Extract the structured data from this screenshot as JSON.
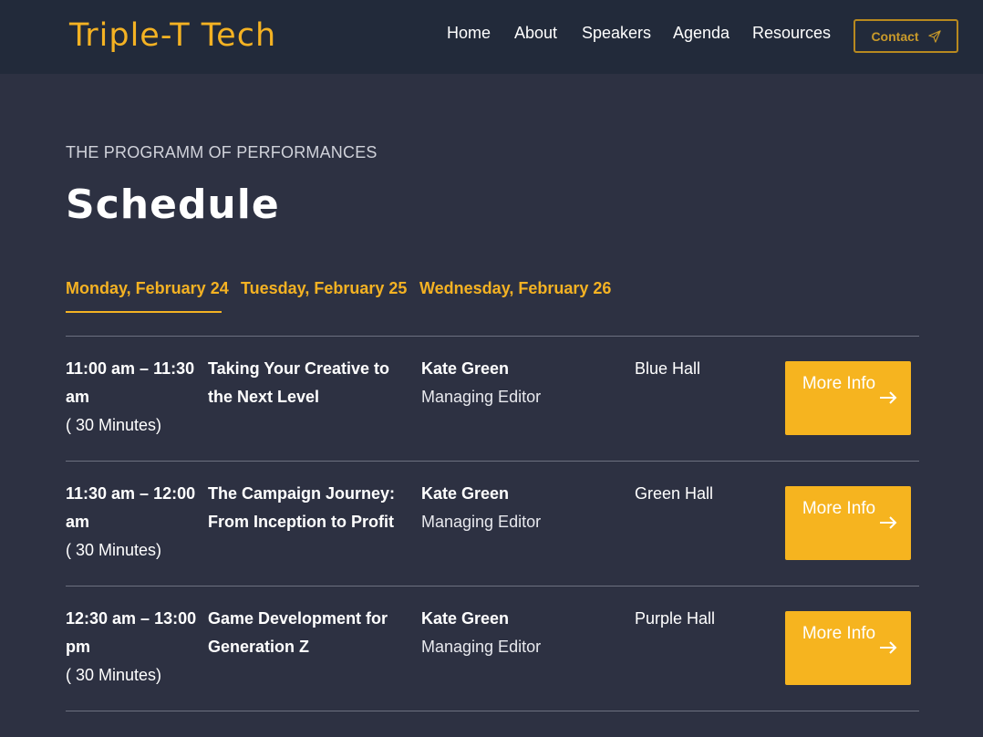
{
  "brand": {
    "logo_text": "Triple-T Tech"
  },
  "nav": {
    "items": [
      "Home",
      "About",
      "Speakers",
      "Agenda",
      "Resources"
    ],
    "contact_label": "Contact"
  },
  "section": {
    "eyebrow": "THE PROGRAMM OF PERFORMANCES",
    "title": "Schedule"
  },
  "days": {
    "tabs": [
      "Monday, February 24",
      "Tuesday, February 25",
      "Wednesday, February 26"
    ],
    "active_index": 0
  },
  "schedule": [
    {
      "time": "11:00 am – 11:30 am",
      "duration": "( 30 Minutes)",
      "talk": "Taking Your Creative to the Next Level",
      "speaker": "Kate Green",
      "role": "Managing Editor",
      "hall": "Blue Hall",
      "button": "More Info"
    },
    {
      "time": "11:30 am – 12:00 am",
      "duration": "( 30 Minutes)",
      "talk": "The Campaign Journey: From Inception to Profit",
      "speaker": "Kate Green",
      "role": "Managing Editor",
      "hall": "Green Hall",
      "button": "More Info"
    },
    {
      "time": "12:30 am – 13:00 pm",
      "duration": "( 30 Minutes)",
      "talk": "Game Development for Generation Z",
      "speaker": "Kate Green",
      "role": "Managing Editor",
      "hall": "Purple Hall",
      "button": "More Info"
    }
  ],
  "colors": {
    "header_bg": "#222a3a",
    "page_bg": "#2d3142",
    "accent": "#f4b223",
    "divider": "#6c7080"
  },
  "icons": {
    "contact": "paper-plane-icon",
    "more": "arrow-right-icon"
  }
}
